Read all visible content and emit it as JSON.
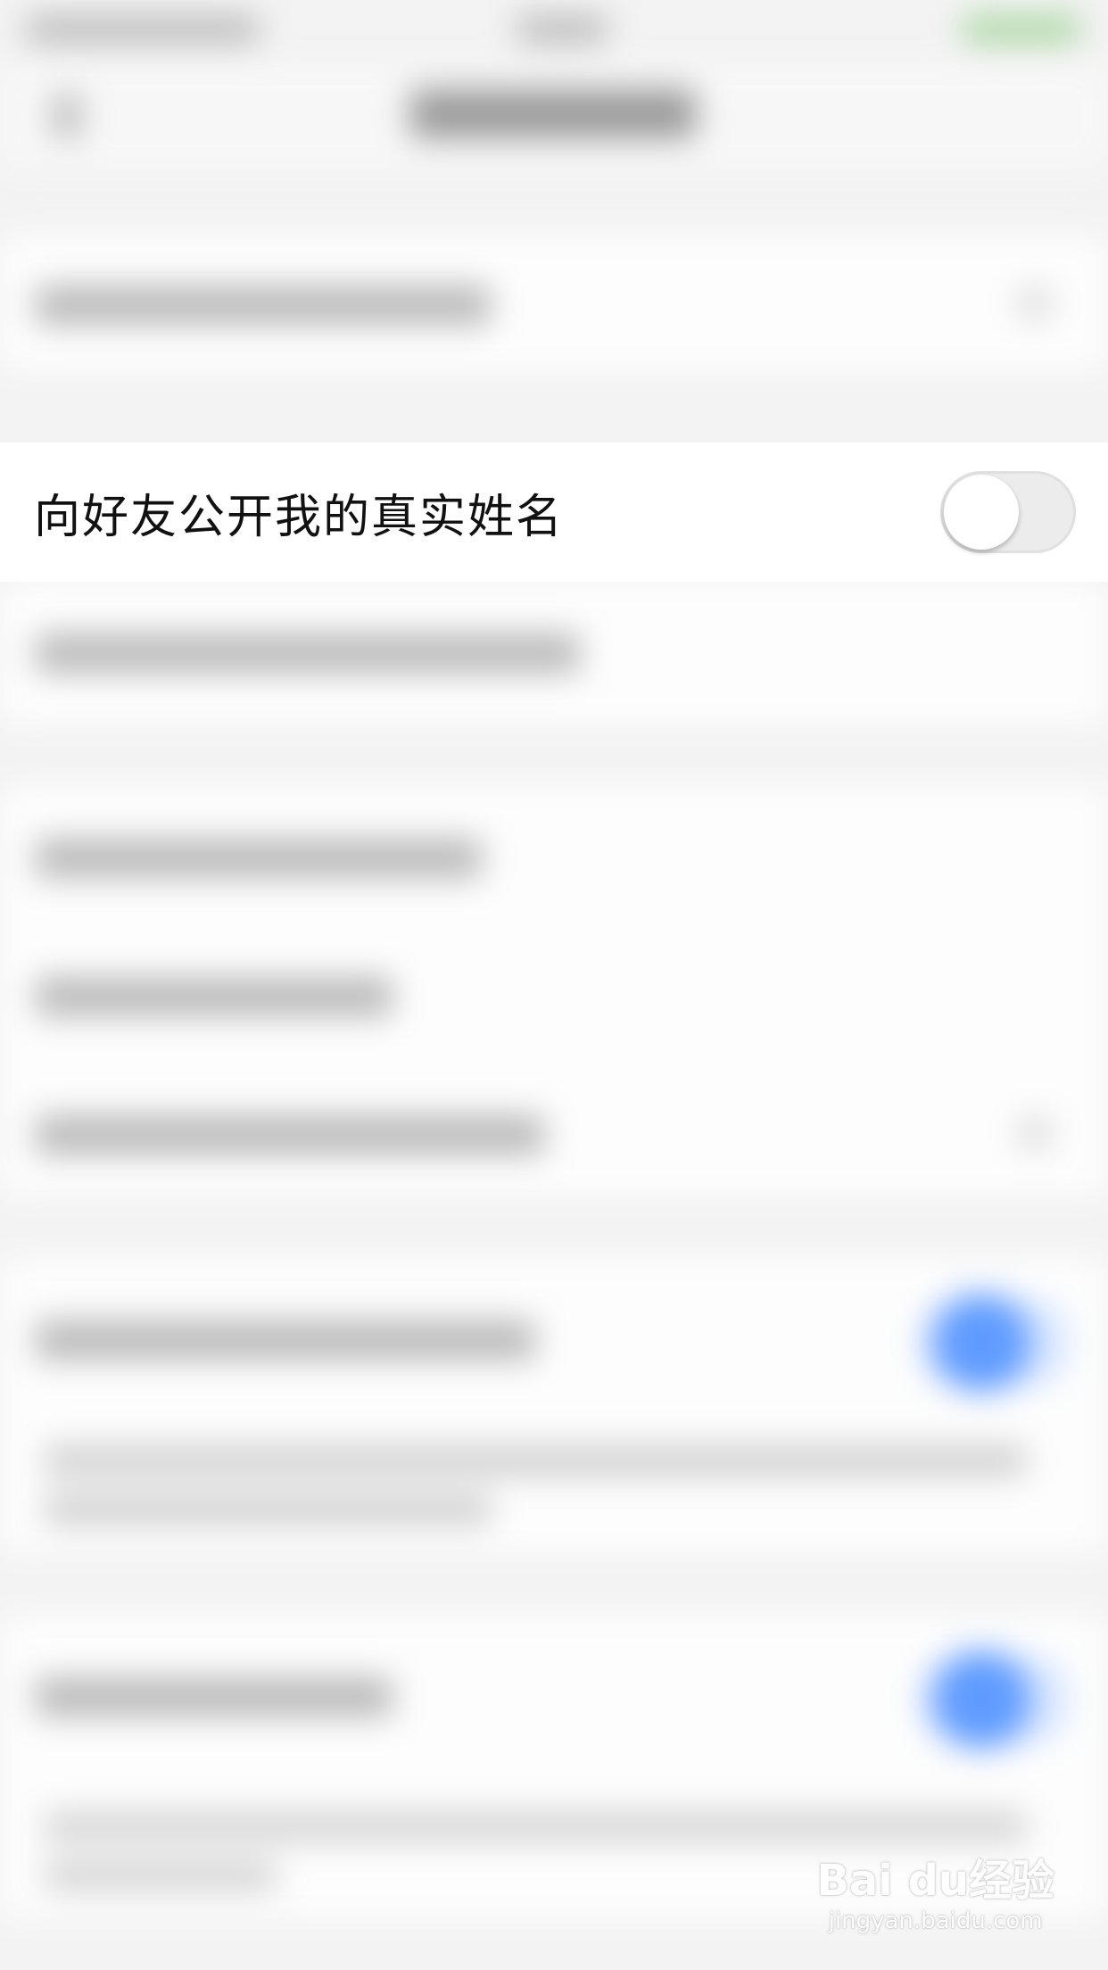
{
  "privacy_row": {
    "label": "向好友公开我的真实姓名",
    "toggle_on": false
  },
  "watermark": {
    "logo": "Bai du经验",
    "url": "jingyan.baidu.com"
  },
  "colors": {
    "toggle_on_blue": "#5f9bff",
    "toggle_off_track": "#ececec",
    "row_background": "#ffffff",
    "page_background": "#f3f3f3"
  }
}
